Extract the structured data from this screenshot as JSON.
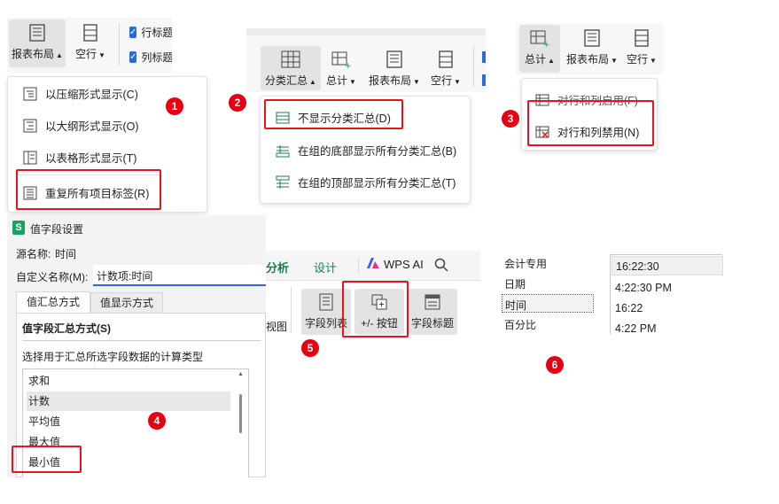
{
  "panel1": {
    "report_layout": "报表布局",
    "blank_rows": "空行",
    "check_row_header": "行标题",
    "check_col_header": "列标题",
    "menu_items": [
      "以压缩形式显示(C)",
      "以大纲形式显示(O)",
      "以表格形式显示(T)",
      "重复所有项目标签(R)"
    ],
    "badge": "1"
  },
  "panel2": {
    "subtotals": "分类汇总",
    "grand_totals": "总计",
    "report_layout": "报表布局",
    "blank_rows": "空行",
    "menu_items": [
      "不显示分类汇总(D)",
      "在组的底部显示所有分类汇总(B)",
      "在组的顶部显示所有分类汇总(T)"
    ],
    "badge": "2"
  },
  "panel3": {
    "grand_totals": "总计",
    "report_layout": "报表布局",
    "blank_rows": "空行",
    "menu_items": [
      "对行和列启用(F)",
      "对行和列禁用(N)"
    ],
    "badge": "3"
  },
  "panel4": {
    "dialog_title": "值字段设置",
    "app_icon_letter": "S",
    "source_name_label": "源名称:",
    "source_name_value": "时间",
    "custom_name_label": "自定义名称(M):",
    "custom_name_value": "计数项:时间",
    "tabs": [
      "值汇总方式",
      "值显示方式"
    ],
    "section_title": "值字段汇总方式(S)",
    "description": "选择用于汇总所选字段数据的计算类型",
    "list_items": [
      "求和",
      "计数",
      "平均值",
      "最大值",
      "最小值"
    ],
    "badge": "4"
  },
  "panel5": {
    "tab_analyze": "分析",
    "tab_design": "设计",
    "wps_ai": "WPS AI",
    "view_partial": "视图",
    "field_list": "字段列表",
    "plus_minus": "+/- 按钮",
    "field_headers": "字段标题",
    "badge": "5"
  },
  "panel6": {
    "categories": [
      "会计专用",
      "日期",
      "时间",
      "百分比"
    ],
    "time_formats": [
      "16:22:30",
      "4:22:30 PM",
      "16:22",
      "4:22 PM"
    ],
    "badge": "6"
  },
  "colors": {
    "highlight_red": "#e8141b",
    "badge_red": "#e60012",
    "accent_blue": "#2a6bd8",
    "wps_green": "#1aa260",
    "design_tab_green": "#1a7f4b"
  }
}
